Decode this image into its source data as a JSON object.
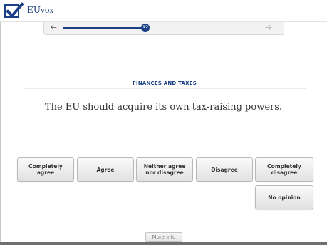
{
  "app": {
    "brand_prefix": "EU",
    "brand_suffix": "vox"
  },
  "progress": {
    "current": 12,
    "fraction": 0.4
  },
  "topic": "FINANCES AND TAXES",
  "question": "The EU should acquire its own tax-raising powers.",
  "answers": [
    "Completely\nagree",
    "Agree",
    "Neither agree\nnor disagree",
    "Disagree",
    "Completely\ndisagree"
  ],
  "no_opinion": "No opinion",
  "more_info": "More info",
  "colors": {
    "accent": "#1b3f86"
  },
  "icons": {
    "logo": "checkbox-check-icon",
    "back": "arrow-left-icon",
    "forward": "arrow-right-icon"
  }
}
